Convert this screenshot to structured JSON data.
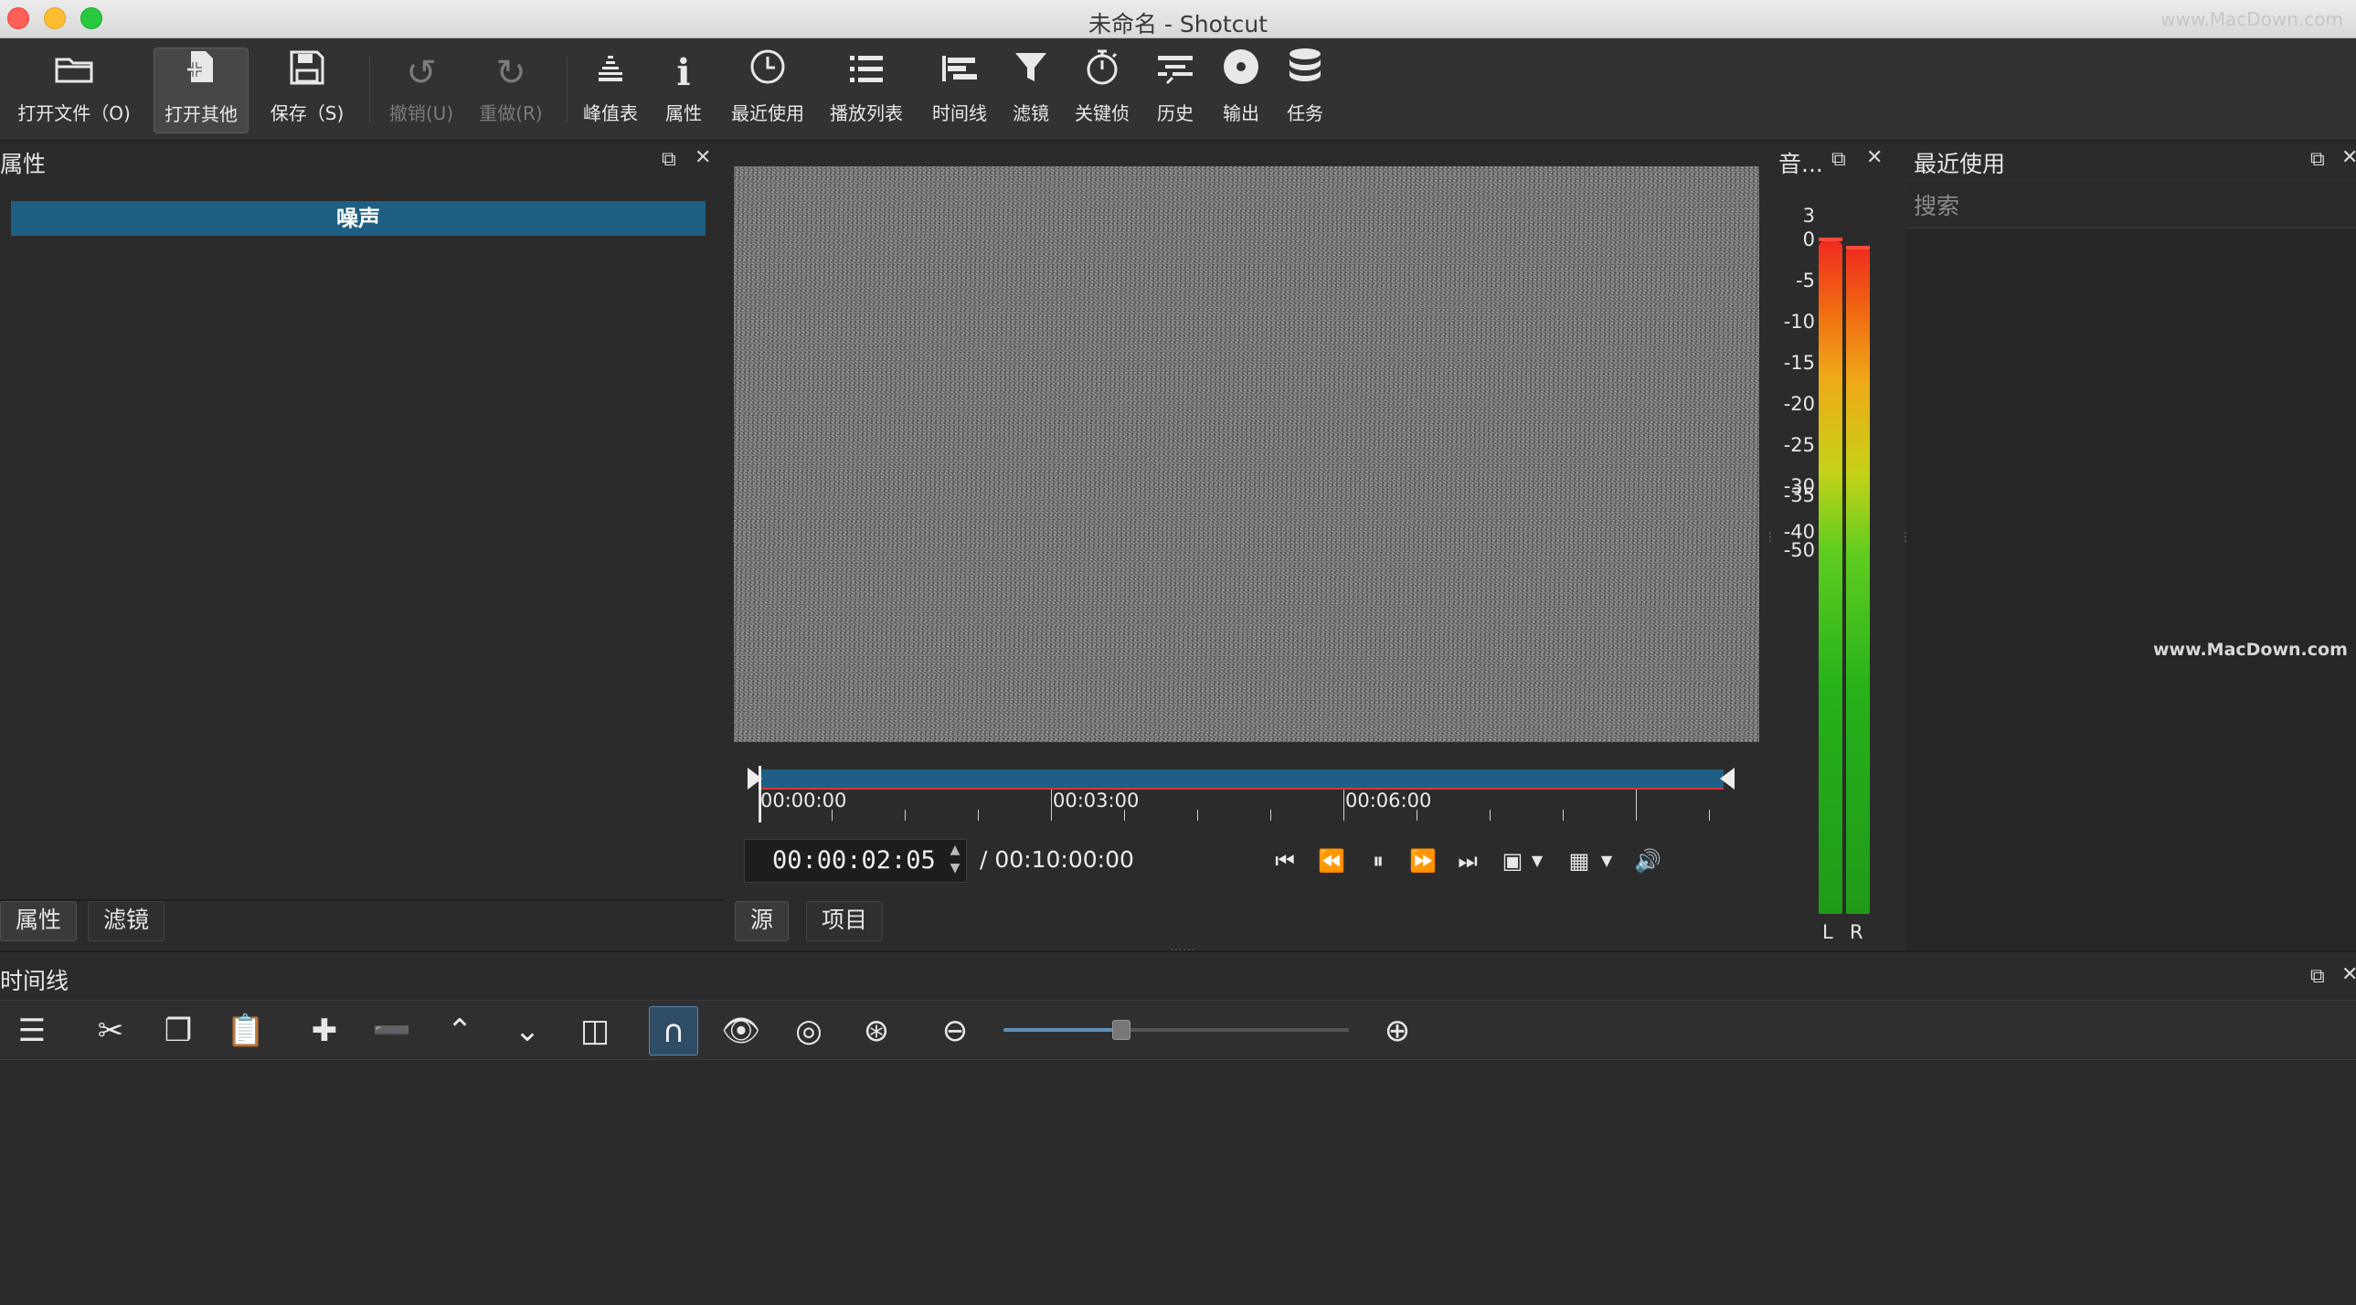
{
  "window": {
    "title": "未命名 - Shotcut",
    "watermark": "www.MacDown.com"
  },
  "toolbar": {
    "open_file": "打开文件（O)",
    "open_other": "打开其他",
    "save": "保存（S)",
    "undo": "撤销(U)",
    "redo": "重做(R)",
    "peak_meter": "峰值表",
    "properties": "属性",
    "recent": "最近使用",
    "playlist": "播放列表",
    "timeline": "时间线",
    "filters": "滤镜",
    "keyframes": "关键侦",
    "history": "历史",
    "export": "输出",
    "jobs": "任务"
  },
  "properties_panel": {
    "title": "属性",
    "selected_item": "噪声",
    "tabs": [
      "属性",
      "滤镜"
    ]
  },
  "player": {
    "ruler_labels": [
      "00:00:00",
      "00:03:00",
      "00:06:00"
    ],
    "timecode": "00:00:02:05",
    "duration": "/ 00:10:00:00",
    "tabs": [
      "源",
      "项目"
    ],
    "playhead_fraction": 0.0
  },
  "audio_meter": {
    "title": "音...",
    "scale": [
      "3",
      "0",
      "-5",
      "-10",
      "-15",
      "-20",
      "-25",
      "-30",
      "-35",
      "-40",
      "-50"
    ],
    "channels": [
      "L",
      "R"
    ],
    "level_db": {
      "L": 0,
      "R": -0.5
    }
  },
  "recent_panel": {
    "title": "最近使用",
    "search_placeholder": "搜索",
    "watermark": "www.MacDown.com"
  },
  "timeline_panel": {
    "title": "时间线",
    "zoom_fraction": 0.34
  },
  "icons": {
    "open_file": "folder-icon",
    "open_other": "open-other-icon",
    "save": "floppy-icon",
    "undo": "undo-icon",
    "redo": "redo-icon",
    "peak_meter": "bar-meter-icon",
    "properties": "info-icon",
    "recent": "clock-icon",
    "playlist": "list-icon",
    "timeline": "timeline-icon",
    "filters": "funnel-icon",
    "keyframes": "stopwatch-icon",
    "history": "history-icon",
    "export": "disc-icon",
    "jobs": "database-icon"
  },
  "colors": {
    "selection": "#1e5f83",
    "background": "#2b2b2b",
    "out_point": "#d7373d"
  }
}
